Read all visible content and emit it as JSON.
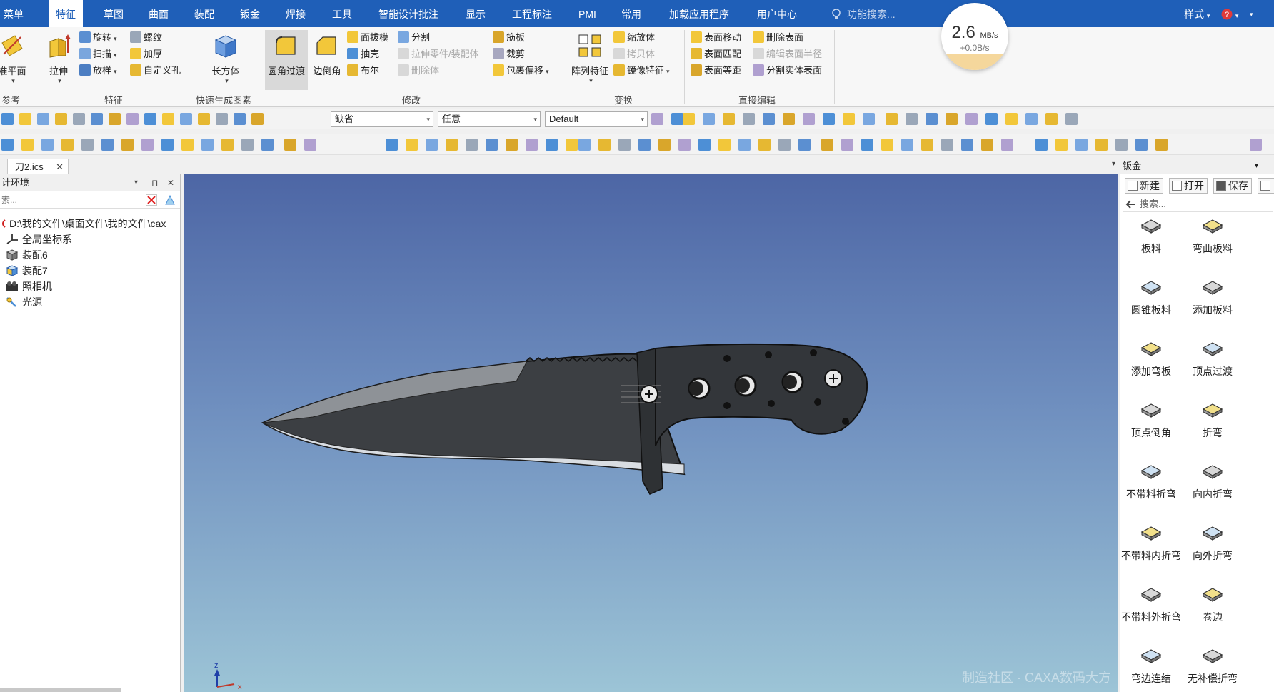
{
  "menubar": {
    "tabs": [
      {
        "label": "菜单",
        "active": false
      },
      {
        "label": "特征",
        "active": true
      },
      {
        "label": "草图",
        "active": false
      },
      {
        "label": "曲面",
        "active": false
      },
      {
        "label": "装配",
        "active": false
      },
      {
        "label": "钣金",
        "active": false
      },
      {
        "label": "焊接",
        "active": false
      },
      {
        "label": "工具",
        "active": false
      },
      {
        "label": "智能设计批注",
        "active": false
      },
      {
        "label": "显示",
        "active": false
      },
      {
        "label": "工程标注",
        "active": false
      },
      {
        "label": "PMI",
        "active": false
      },
      {
        "label": "常用",
        "active": false
      },
      {
        "label": "加载应用程序",
        "active": false
      },
      {
        "label": "用户中心",
        "active": false
      }
    ],
    "search_placeholder": "功能搜索...",
    "style_label": "样式",
    "style_arrow": "▾",
    "help_arrow": "▾",
    "more_arrow": "▾"
  },
  "speed_badge": {
    "value": "2.6",
    "unit": "MB/s",
    "sub": "+0.0B/s"
  },
  "ribbon": {
    "groups": [
      {
        "label": "参考"
      },
      {
        "label": "特征"
      },
      {
        "label": "快速生成图素"
      },
      {
        "label": "修改"
      },
      {
        "label": "变换"
      },
      {
        "label": "直接编辑"
      }
    ],
    "big_buttons": [
      {
        "label": "准平面"
      },
      {
        "label": "拉伸"
      },
      {
        "label": "长方体"
      },
      {
        "label": "圆角过渡"
      },
      {
        "label": "边倒角"
      },
      {
        "label": "阵列特征"
      }
    ],
    "feature_small": [
      "旋转",
      "扫描",
      "放样",
      "螺纹",
      "加厚",
      "自定义孔"
    ],
    "modify_small": [
      "面拔模",
      "抽壳",
      "布尔",
      "分割",
      "拉伸零件/装配体",
      "删除体",
      "筋板",
      "裁剪",
      "包裹偏移"
    ],
    "transform_small": [
      "缩放体",
      "拷贝体",
      "镜像特征"
    ],
    "direct_small": [
      "表面移动",
      "表面匹配",
      "表面等距",
      "删除表面",
      "编辑表面半径",
      "分割实体表面"
    ]
  },
  "toolbar": {
    "combo1": "缺省",
    "combo2": "任意",
    "combo3": "Default",
    "combo_arrow": "▾"
  },
  "doc_tab": {
    "label": "刀2.ics",
    "close": "✕"
  },
  "left_panel": {
    "title": "计环境",
    "title_arrow": "▾",
    "pin": "⊓",
    "close": "✕",
    "search_placeholder": "索...",
    "tree": [
      {
        "label": "D:\\我的文件\\桌面文件\\我的文件\\cax",
        "icon": "file-icon"
      },
      {
        "label": "全局坐标系",
        "icon": "axis-icon"
      },
      {
        "label": "装配6",
        "icon": "assembly-icon"
      },
      {
        "label": "装配7",
        "icon": "assembly-icon"
      },
      {
        "label": "照相机",
        "icon": "camera-icon"
      },
      {
        "label": "光源",
        "icon": "light-icon"
      }
    ]
  },
  "viewport": {
    "axis_z": "z",
    "axis_x": "x",
    "watermark": "制造社区 · CAXA数码大方",
    "collapse_arrow": "▾"
  },
  "right_panel": {
    "title": "钣金",
    "title_arrow": "▾",
    "buttons": [
      {
        "label": "新建"
      },
      {
        "label": "打开"
      },
      {
        "label": "保存"
      }
    ],
    "search_placeholder": "搜索...",
    "items": [
      {
        "label": "板料"
      },
      {
        "label": "弯曲板料"
      },
      {
        "label": "圆锥板料"
      },
      {
        "label": "添加板料"
      },
      {
        "label": "添加弯板"
      },
      {
        "label": "顶点过渡"
      },
      {
        "label": "顶点倒角"
      },
      {
        "label": "折弯"
      },
      {
        "label": "不带料折弯"
      },
      {
        "label": "向内折弯"
      },
      {
        "label": "不带料内折弯"
      },
      {
        "label": "向外折弯"
      },
      {
        "label": "不带料外折弯"
      },
      {
        "label": "卷边"
      },
      {
        "label": "弯边连结"
      },
      {
        "label": "无补偿折弯"
      }
    ]
  },
  "colors": {
    "menubar": "#1f5fb8",
    "viewport_top": "#4d66a5",
    "viewport_bottom": "#9cc4d6",
    "icon_yellow": "#f2c73a",
    "icon_blue": "#4d8fd6"
  }
}
